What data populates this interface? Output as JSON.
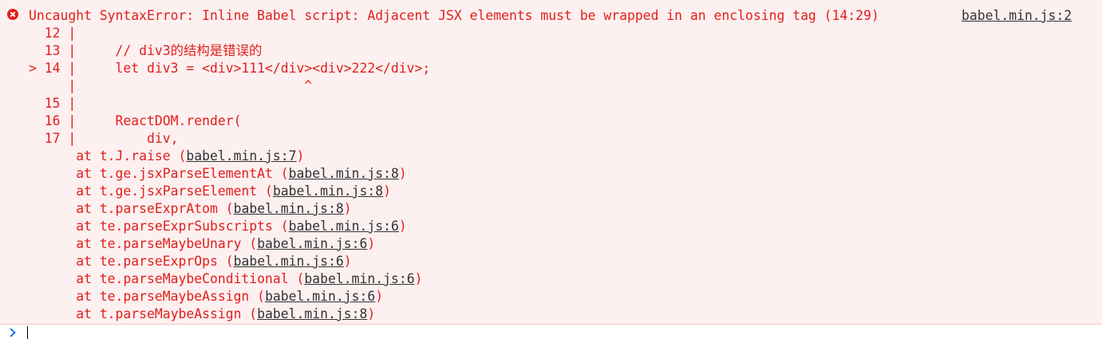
{
  "error": {
    "message": "Uncaught SyntaxError: Inline Babel script: Adjacent JSX elements must be wrapped in an enclosing tag (14:29)",
    "source": "babel.min.js:2",
    "code_lines": [
      "  12 |",
      "  13 |     // div3的结构是错误的",
      "> 14 |     let div3 = <div>111</div><div>222</div>;",
      "     |                             ^",
      "  15 |",
      "  16 |     ReactDOM.render(",
      "  17 |         div,"
    ],
    "stack": [
      {
        "fn": "t.J.raise",
        "file": "babel.min.js:7"
      },
      {
        "fn": "t.ge.jsxParseElementAt",
        "file": "babel.min.js:8"
      },
      {
        "fn": "t.ge.jsxParseElement",
        "file": "babel.min.js:8"
      },
      {
        "fn": "t.parseExprAtom",
        "file": "babel.min.js:8"
      },
      {
        "fn": "te.parseExprSubscripts",
        "file": "babel.min.js:6"
      },
      {
        "fn": "te.parseMaybeUnary",
        "file": "babel.min.js:6"
      },
      {
        "fn": "te.parseExprOps",
        "file": "babel.min.js:6"
      },
      {
        "fn": "te.parseMaybeConditional",
        "file": "babel.min.js:6"
      },
      {
        "fn": "te.parseMaybeAssign",
        "file": "babel.min.js:6"
      },
      {
        "fn": "t.parseMaybeAssign",
        "file": "babel.min.js:8"
      }
    ]
  },
  "colors": {
    "error_text": "#e0201c",
    "error_background": "#fdf0f0",
    "link_text": "#333333",
    "prompt_accent": "#1a73e8"
  },
  "icons": {
    "error": "error-circle-icon",
    "prompt": "chevron-right-icon"
  }
}
